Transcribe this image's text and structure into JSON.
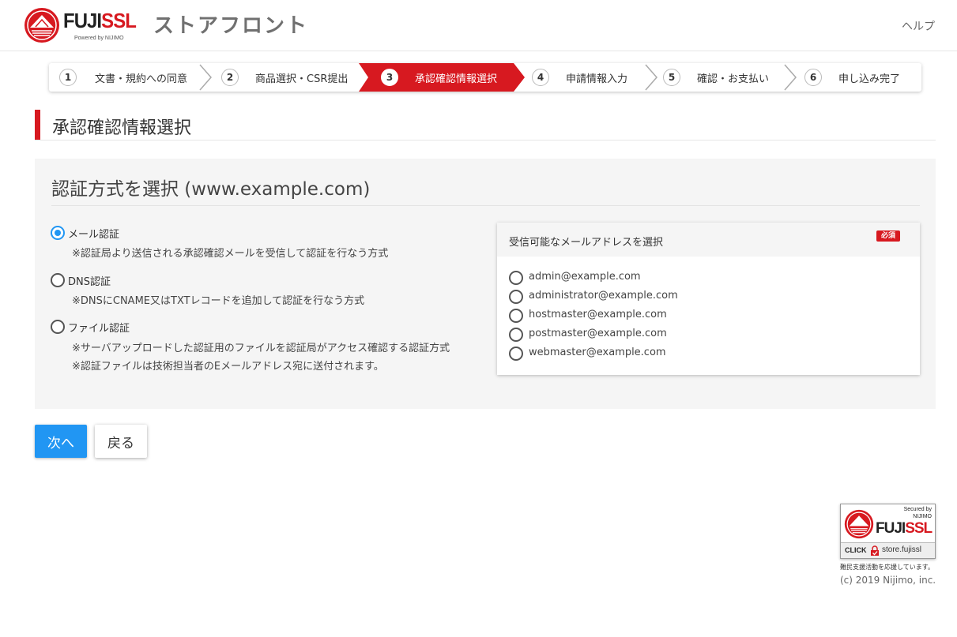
{
  "header": {
    "logo_text": "FUJISSL",
    "logo_powered": "Powered by NIJIMO",
    "store_title": "ストアフロント",
    "help_label": "ヘルプ"
  },
  "steps": [
    {
      "num": "1",
      "label": "文書・規約への同意",
      "active": false
    },
    {
      "num": "2",
      "label": "商品選択・CSR提出",
      "active": false
    },
    {
      "num": "3",
      "label": "承認確認情報選択",
      "active": true
    },
    {
      "num": "4",
      "label": "申請情報入力",
      "active": false
    },
    {
      "num": "5",
      "label": "確認・お支払い",
      "active": false
    },
    {
      "num": "6",
      "label": "申し込み完了",
      "active": false
    }
  ],
  "page_title": "承認確認情報選択",
  "panel": {
    "title": "認証方式を選択 (www.example.com)",
    "methods": [
      {
        "label": "メール認証",
        "checked": true,
        "desc": [
          "※認証局より送信される承認確認メールを受信して認証を行なう方式"
        ]
      },
      {
        "label": "DNS認証",
        "checked": false,
        "desc": [
          "※DNSにCNAME又はTXTレコードを追加して認証を行なう方式"
        ]
      },
      {
        "label": "ファイル認証",
        "checked": false,
        "desc": [
          "※サーバアップロードした認証用のファイルを認証局がアクセス確認する認証方式",
          "※認証ファイルは技術担当者のEメールアドレス宛に送付されます。"
        ]
      }
    ],
    "email_card": {
      "title": "受信可能なメールアドレスを選択",
      "required_badge": "必須",
      "addresses": [
        "admin@example.com",
        "administrator@example.com",
        "hostmaster@example.com",
        "postmaster@example.com",
        "webmaster@example.com"
      ]
    }
  },
  "buttons": {
    "next": "次へ",
    "back": "戻る"
  },
  "footer": {
    "badge_secured": "Secured by",
    "badge_secured_by": "NIJIMO",
    "badge_brand": "FUJISSL",
    "badge_click": "CLICK",
    "badge_store": "store.fujissl",
    "badge_caption": "難民支援活動を応援しています。",
    "copyright": "(c) 2019 Nijimo, inc."
  },
  "colors": {
    "accent_red": "#d71920",
    "primary_blue": "#2196f3"
  }
}
